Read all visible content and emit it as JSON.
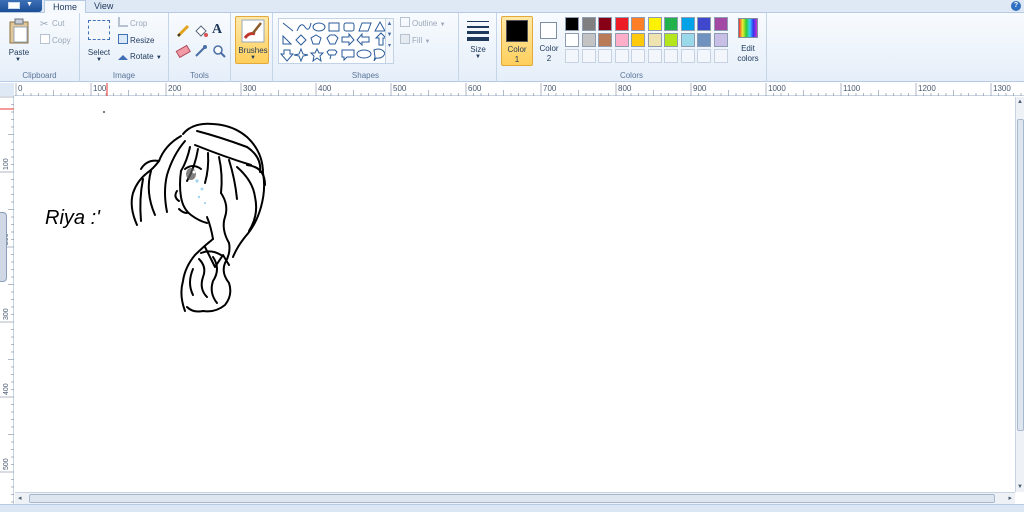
{
  "tabs": {
    "home": "Home",
    "view": "View"
  },
  "clipboard": {
    "paste": "Paste",
    "cut": "Cut",
    "copy": "Copy",
    "label": "Clipboard"
  },
  "image": {
    "select": "Select",
    "crop": "Crop",
    "resize": "Resize",
    "rotate": "Rotate",
    "label": "Image"
  },
  "tools": {
    "text_tool": "A",
    "label": "Tools"
  },
  "brushes": {
    "label": "Brushes"
  },
  "shapes": {
    "outline": "Outline",
    "fill": "Fill",
    "label": "Shapes"
  },
  "size": {
    "label": "Size"
  },
  "colors": {
    "color1": "Color 1",
    "color1_line1": "Color",
    "color1_line2": "1",
    "color2_line1": "Color",
    "color2_line2": "2",
    "edit_line1": "Edit",
    "edit_line2": "colors",
    "label": "Colors",
    "current_color1": "#000000",
    "current_color2": "#ffffff",
    "palette_row1": [
      "#000000",
      "#7f7f7f",
      "#880015",
      "#ed1c24",
      "#ff7f27",
      "#fff200",
      "#22b14c",
      "#00a2e8",
      "#3f48cc",
      "#a349a4"
    ],
    "palette_row2": [
      "#ffffff",
      "#c3c3c3",
      "#b97a57",
      "#ffaec9",
      "#ffc90e",
      "#efe4b0",
      "#b5e61d",
      "#99d9ea",
      "#7092be",
      "#c8bfe7"
    ]
  },
  "ruler": {
    "h": [
      "0",
      "100",
      "200",
      "300",
      "400",
      "500",
      "600",
      "700",
      "800",
      "900",
      "1000",
      "1100",
      "1200",
      "1300"
    ],
    "v": [
      "100",
      "200",
      "300",
      "400",
      "500"
    ]
  },
  "canvas": {
    "handwritten_text": "Riya :'"
  }
}
